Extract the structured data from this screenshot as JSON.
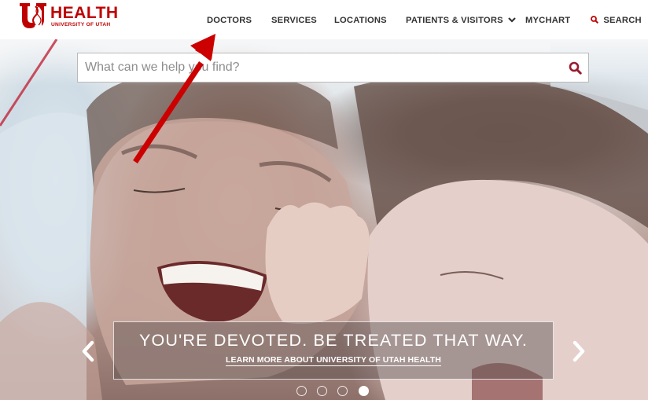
{
  "header": {
    "logo": {
      "wordmark": "HEALTH",
      "subtitle": "UNIVERSITY OF UTAH",
      "mark_icon": "u-of-u-block-u-icon",
      "brand_color": "#be0000"
    },
    "nav": [
      {
        "label": "DOCTORS"
      },
      {
        "label": "SERVICES"
      },
      {
        "label": "LOCATIONS"
      },
      {
        "label": "PATIENTS & VISITORS",
        "icon": "chevron-down-icon"
      },
      {
        "label": "MYCHART"
      },
      {
        "label": "SEARCH",
        "icon": "search-icon"
      }
    ]
  },
  "hero": {
    "search": {
      "placeholder": "What can we help you find?",
      "value": "",
      "button_icon": "search-icon"
    },
    "caption": {
      "title": "YOU'RE DEVOTED. BE TREATED THAT WAY.",
      "link": "LEARN MORE ABOUT UNIVERSITY OF UTAH HEALTH"
    },
    "carousel": {
      "prev_icon": "chevron-left-icon",
      "next_icon": "chevron-right-icon",
      "slides": 4,
      "active_slide": 4
    },
    "image_description": "Smiling father and young child lying face to face on white bedding"
  },
  "annotation": {
    "type": "arrow",
    "color": "#cc0000",
    "points_to": "DOCTORS"
  }
}
